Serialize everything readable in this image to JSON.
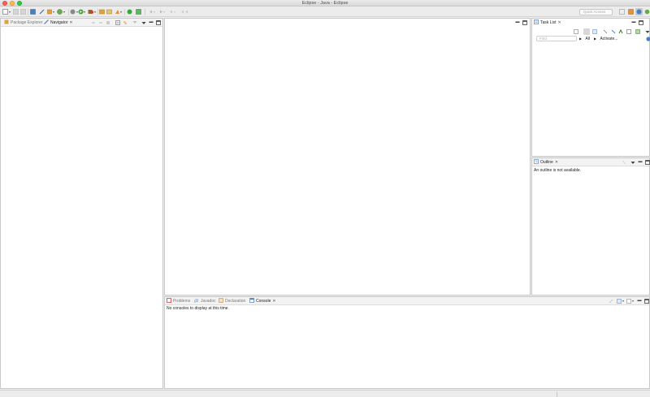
{
  "window": {
    "title": "Eclipse - Java - Eclipse"
  },
  "toolbar": {
    "quick_access_placeholder": "Quick Access",
    "icons": [
      "new-icon",
      "save-icon",
      "save-all-icon",
      "print-icon",
      "open-type-icon",
      "search-icon",
      "debug-icon",
      "run-icon",
      "external-tools-icon",
      "new-java-project-icon",
      "new-package-icon",
      "new-class-icon",
      "open-perspective-icon",
      "back-icon",
      "forward-icon",
      "java-perspective-icon",
      "debug-perspective-icon"
    ]
  },
  "left_panel": {
    "tabs": [
      {
        "label": "Package Explorer",
        "active": false
      },
      {
        "label": "Navigator",
        "active": true
      }
    ]
  },
  "task_list": {
    "tab_label": "Task List",
    "find_placeholder": "Find",
    "all_label": "All",
    "activate_label": "Activate..."
  },
  "outline": {
    "tab_label": "Outline",
    "message": "An outline is not available."
  },
  "bottom_panel": {
    "tabs": [
      {
        "label": "Problems",
        "active": false
      },
      {
        "label": "Javadoc",
        "active": false
      },
      {
        "label": "Declaration",
        "active": false
      },
      {
        "label": "Console",
        "active": true
      }
    ],
    "message": "No consoles to display at this time."
  },
  "colors": {
    "accent": "#3c78d8",
    "panel_bg": "#ffffff",
    "chrome_bg": "#ececec"
  }
}
